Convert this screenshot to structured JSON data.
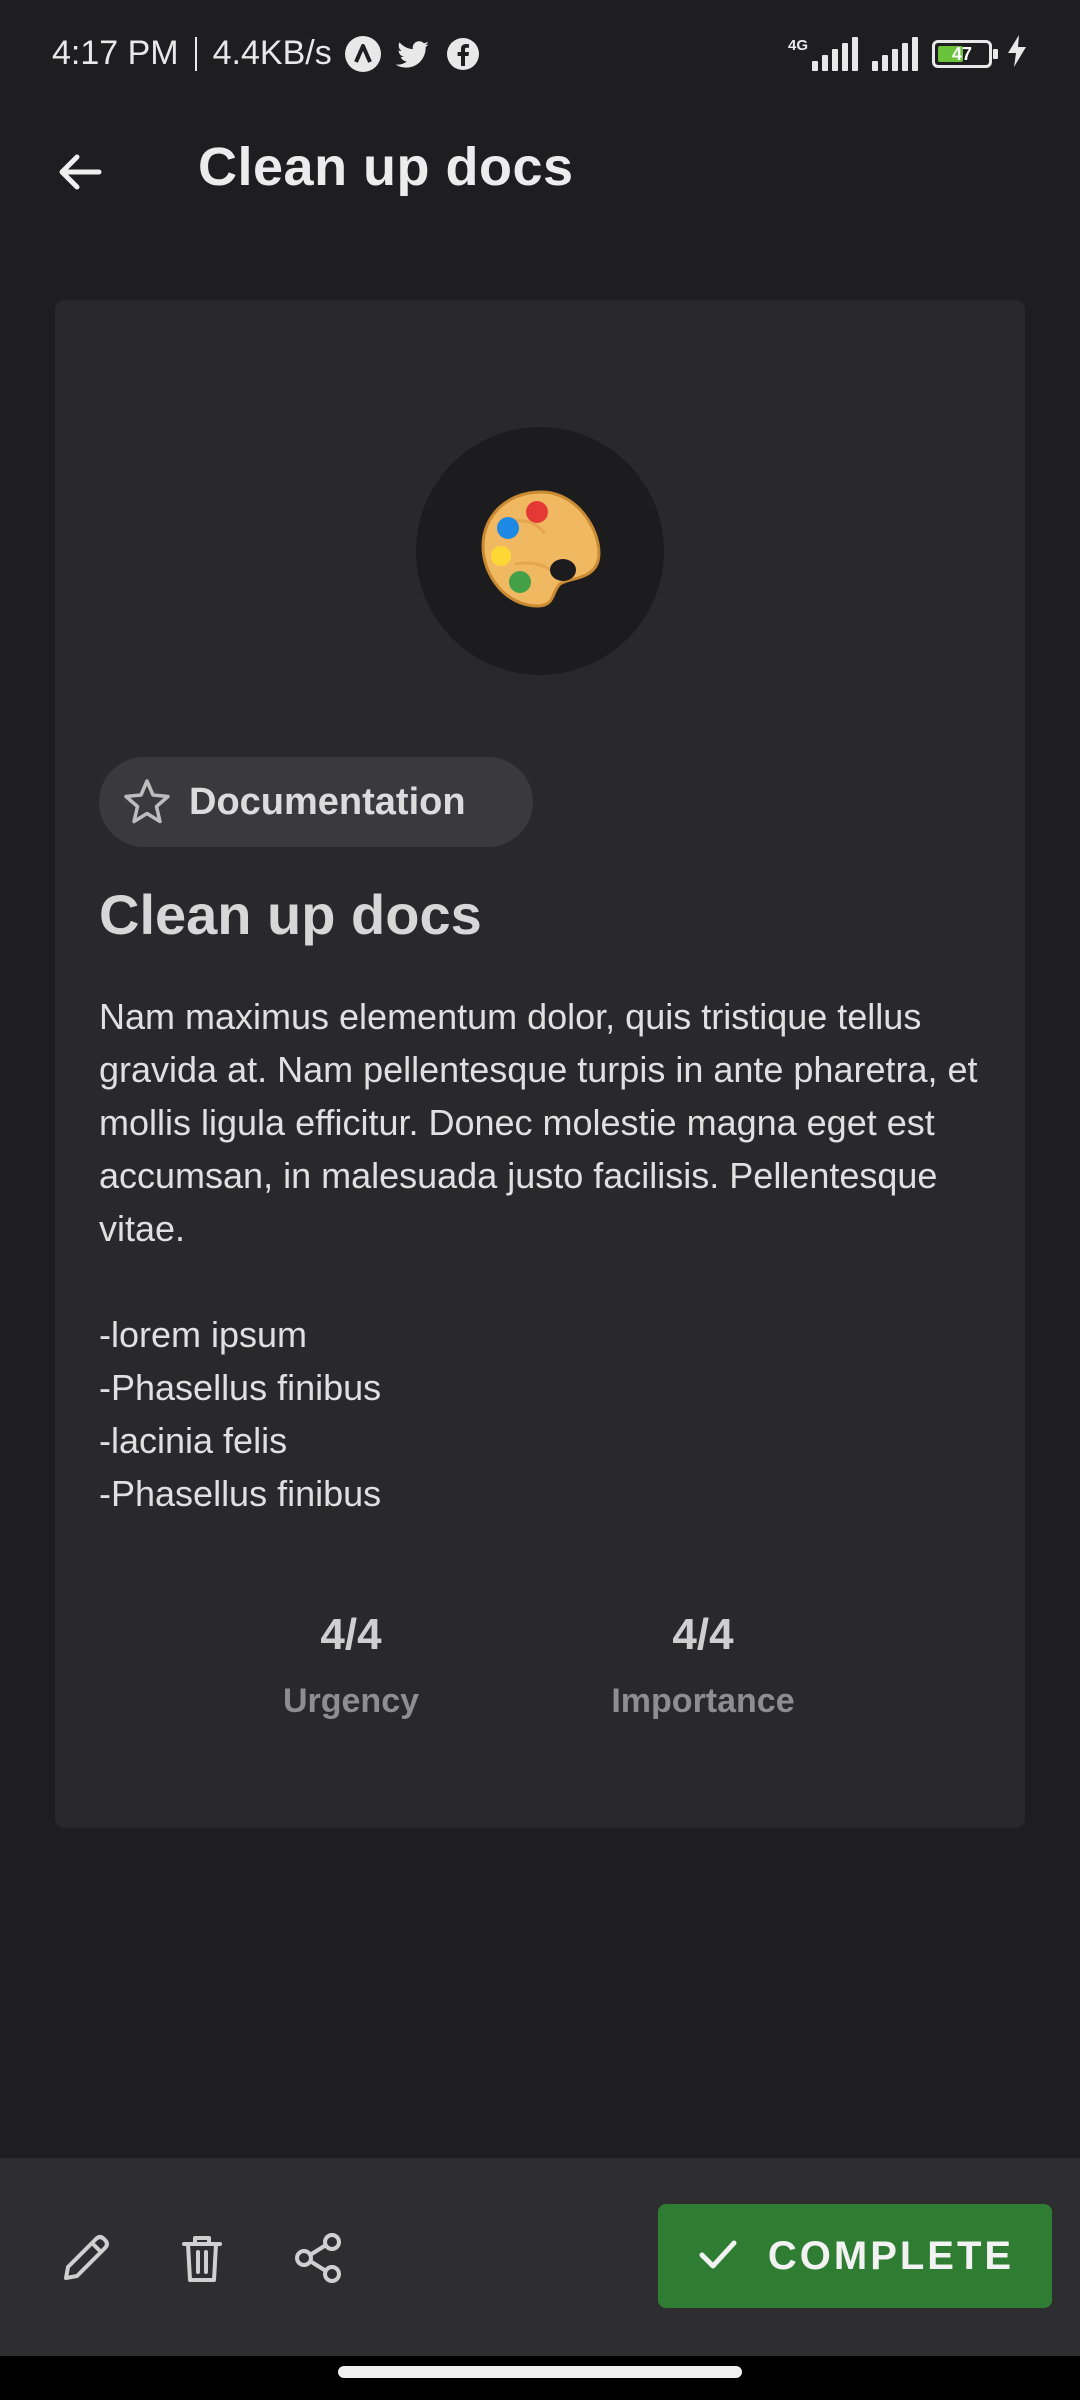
{
  "status_bar": {
    "time": "4:17 PM",
    "speed": "4.4KB/s",
    "network_type": "4G",
    "battery_level": "47",
    "icons": [
      "app-a-icon",
      "twitter-icon",
      "facebook-icon",
      "signal-icon",
      "battery-icon",
      "charging-icon"
    ]
  },
  "app_bar": {
    "title": "Clean up docs",
    "back_icon": "arrow-left-icon"
  },
  "task": {
    "emoji_icon": "palette-icon",
    "category": "Documentation",
    "category_icon": "star-outline-icon",
    "title": "Clean up docs",
    "description": "Nam maximus elementum dolor, quis tristique tellus gravida at. Nam pellentesque turpis in ante pharetra, et mollis ligula efficitur. Donec molestie magna eget est accumsan, in malesuada justo facilisis. Pellentesque vitae.\n\n-lorem ipsum\n-Phasellus finibus\n-lacinia felis\n-Phasellus finibus",
    "urgency": {
      "value": "4/4",
      "label": "Urgency"
    },
    "importance": {
      "value": "4/4",
      "label": "Importance"
    }
  },
  "bottom_bar": {
    "actions": [
      "edit-icon",
      "delete-icon",
      "share-icon"
    ],
    "complete_label": "COMPLETE",
    "complete_color": "#2e7d32"
  },
  "colors": {
    "background": "#1e1e20",
    "card": "#29292b",
    "chip": "#3a3a3c",
    "accent_green": "#2e7d32"
  }
}
